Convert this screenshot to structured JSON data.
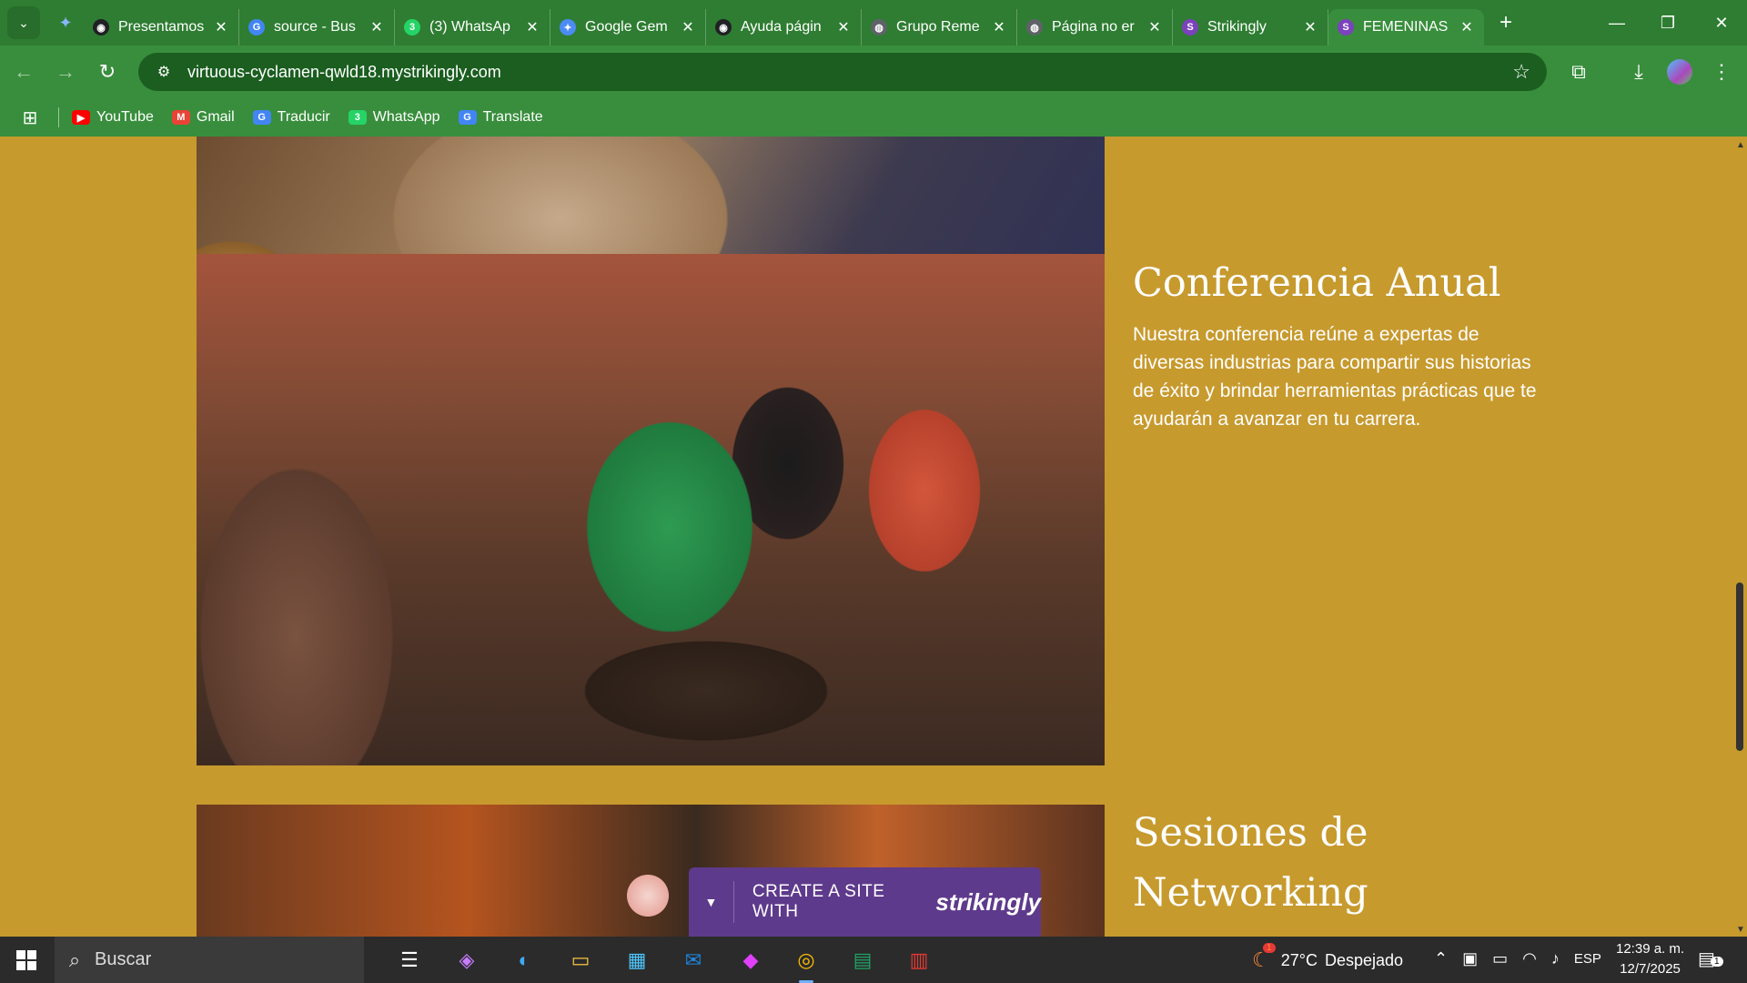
{
  "browser": {
    "tabs": [
      {
        "title": "Presentamos",
        "favicon_color": "#202124",
        "favicon_glyph": "◉"
      },
      {
        "title": "source - Bus",
        "favicon_color": "#4285F4",
        "favicon_glyph": "G"
      },
      {
        "title": "(3) WhatsAp",
        "favicon_color": "#25D366",
        "favicon_glyph": "3"
      },
      {
        "title": "Google Gem",
        "favicon_color": "#4C8BF5",
        "favicon_glyph": "✦"
      },
      {
        "title": "Ayuda págin",
        "favicon_color": "#202124",
        "favicon_glyph": "◉"
      },
      {
        "title": "Grupo Reme",
        "favicon_color": "#5f6368",
        "favicon_glyph": "◍"
      },
      {
        "title": "Página no er",
        "favicon_color": "#5f6368",
        "favicon_glyph": "◍"
      },
      {
        "title": "Strikingly",
        "favicon_color": "#7B42BC",
        "favicon_glyph": "S"
      },
      {
        "title": "FEMENINAS",
        "favicon_color": "#7B42BC",
        "favicon_glyph": "S"
      }
    ],
    "active_tab_index": 8,
    "url": "virtuous-cyclamen-qwld18.mystrikingly.com",
    "bookmarks": [
      {
        "label": "YouTube",
        "color": "#FF0000",
        "glyph": "▶"
      },
      {
        "label": "Gmail",
        "color": "#EA4335",
        "glyph": "M"
      },
      {
        "label": "Traducir",
        "color": "#4285F4",
        "glyph": "G"
      },
      {
        "label": "WhatsApp",
        "color": "#25D366",
        "glyph": "3"
      },
      {
        "label": "Translate",
        "color": "#4285F4",
        "glyph": "G"
      }
    ],
    "theme_color": "#2E7D32"
  },
  "page": {
    "background_color": "#C79A2E",
    "section_conference": {
      "heading": "Conferencia Anual",
      "body": "Nuestra conferencia reúne a expertas de diversas industrias para compartir sus historias de éxito y brindar herramientas prácticas que te ayudarán a avanzar en tu carrera."
    },
    "section_networking": {
      "heading_line1": "Sesiones de",
      "heading_line2": "Networking"
    },
    "promo": {
      "label": "CREATE A SITE WITH",
      "brand": "strikingly",
      "color": "#5E3A8C"
    }
  },
  "taskbar": {
    "search_placeholder": "Buscar",
    "weather_temp": "27°C",
    "weather_text": "Despejado",
    "weather_badge": "1",
    "language": "ESP",
    "time": "12:39 a. m.",
    "date": "12/7/2025",
    "notification_count": "1"
  }
}
